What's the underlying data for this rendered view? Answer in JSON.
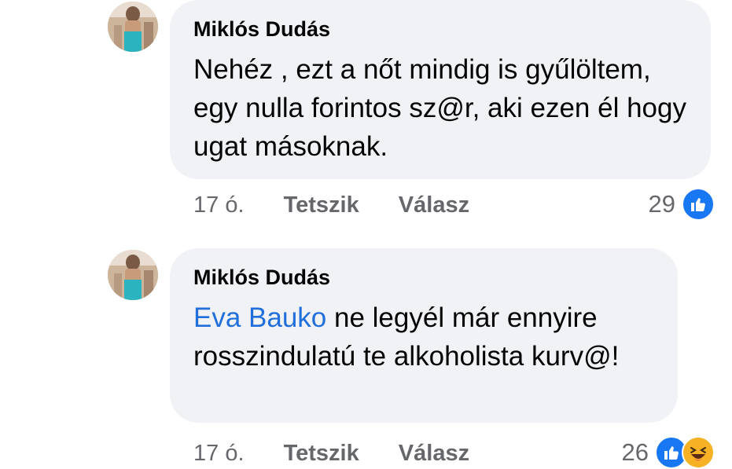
{
  "comments": [
    {
      "author": "Miklós Dudás",
      "text": "Nehéz , ezt a nőt mindig is gyűlöltem, egy nulla forintos sz@r, aki ezen él hogy ugat másoknak.",
      "time": "17 ó.",
      "like_label": "Tetszik",
      "reply_label": "Válasz",
      "reaction_count": "29",
      "reaction_icons": [
        "like-icon"
      ]
    },
    {
      "author": "Miklós Dudás",
      "mention": "Eva Bauko",
      "text": " ne legyél már ennyire rosszindulatú te alkoholista kurv@!",
      "time": "17 ó.",
      "like_label": "Tetszik",
      "reply_label": "Válasz",
      "reaction_count": "26",
      "reaction_icons": [
        "like-icon",
        "haha-icon"
      ]
    }
  ],
  "colors": {
    "bubble": "#f0f2f5",
    "mention": "#216fdb",
    "like": "#1877f2",
    "haha": "#f7b125",
    "meta_text": "#65676b"
  }
}
